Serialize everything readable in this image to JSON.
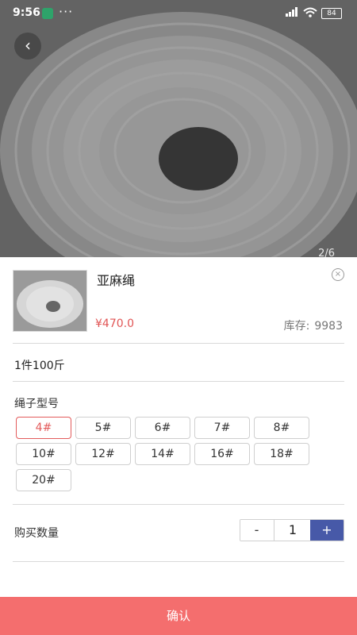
{
  "status_bar": {
    "time": "9:56",
    "more": "···",
    "battery": "84"
  },
  "gallery": {
    "page_indicator": "2/6"
  },
  "product": {
    "title": "亚麻绳",
    "price": "¥470.0",
    "stock_label": "库存:",
    "stock_value": "9983",
    "spec": "1件100斤"
  },
  "options": {
    "title": "绳子型号",
    "items": [
      "4#",
      "5#",
      "6#",
      "7#",
      "8#",
      "10#",
      "12#",
      "14#",
      "16#",
      "18#",
      "20#"
    ],
    "selected": "4#"
  },
  "quantity": {
    "label": "购买数量",
    "minus": "-",
    "value": "1",
    "plus": "+"
  },
  "footer": {
    "confirm": "确认"
  },
  "colors": {
    "accent_red": "#e35b5b",
    "plus_blue": "#4759a8",
    "confirm_bg": "#f46e6e"
  },
  "icons": [
    "back-chevron-icon",
    "close-circle-icon",
    "shield-icon",
    "signal-icon",
    "wifi-icon",
    "battery-icon"
  ]
}
